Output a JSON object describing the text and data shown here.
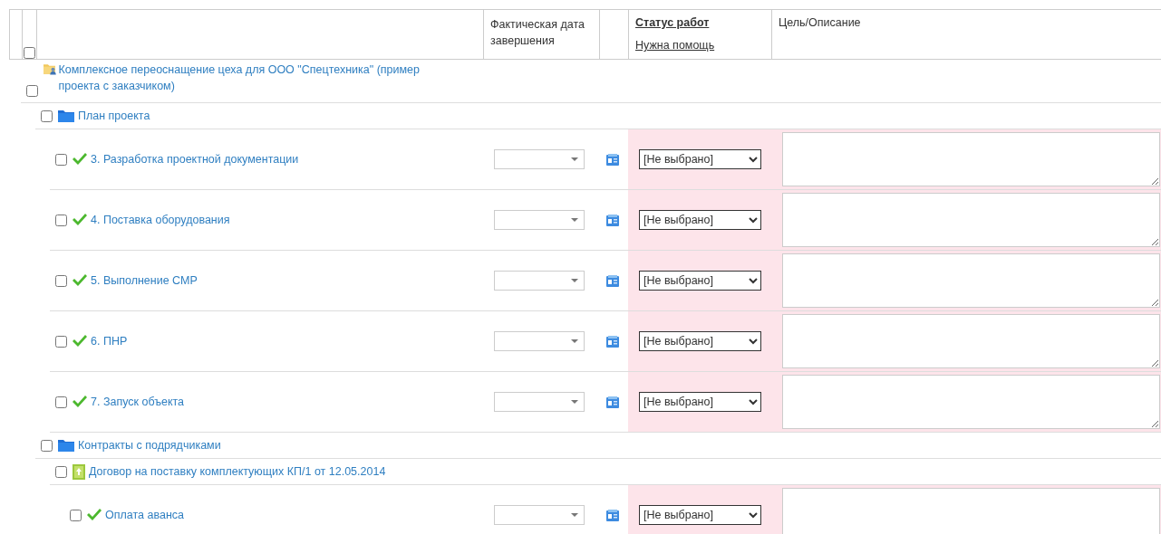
{
  "header": {
    "checked": false,
    "date_column": "Фактическая дата завершения",
    "status_column": "Статус работ",
    "help_link": "Нужна помощь",
    "description_column": "Цель/Описание"
  },
  "tree": [
    {
      "kind": "project",
      "title": "Комплексное переоснащение цеха для ООО \"Спецтехника\" (пример проекта с заказчиком)",
      "checked": false,
      "children": [
        {
          "kind": "folder",
          "title": "План проекта",
          "checked": false,
          "children": [
            {
              "kind": "task",
              "title": "3. Разработка проектной документации",
              "checked": false,
              "status": "[Не выбрано]"
            },
            {
              "kind": "task",
              "title": "4. Поставка оборудования",
              "checked": false,
              "status": "[Не выбрано]"
            },
            {
              "kind": "task",
              "title": "5. Выполнение СМР",
              "checked": false,
              "status": "[Не выбрано]"
            },
            {
              "kind": "task",
              "title": "6. ПНР",
              "checked": false,
              "status": "[Не выбрано]"
            },
            {
              "kind": "task",
              "title": "7. Запуск объекта",
              "checked": false,
              "status": "[Не выбрано]"
            }
          ]
        },
        {
          "kind": "folder",
          "title": "Контракты с подрядчиками",
          "checked": false,
          "children": [
            {
              "kind": "contract",
              "title": "Договор на поставку комплектующих КП/1 от 12.05.2014",
              "checked": false,
              "children": [
                {
                  "kind": "task",
                  "title": "Оплата аванса",
                  "checked": false,
                  "status": "[Не выбрано]"
                }
              ]
            }
          ]
        }
      ]
    }
  ]
}
